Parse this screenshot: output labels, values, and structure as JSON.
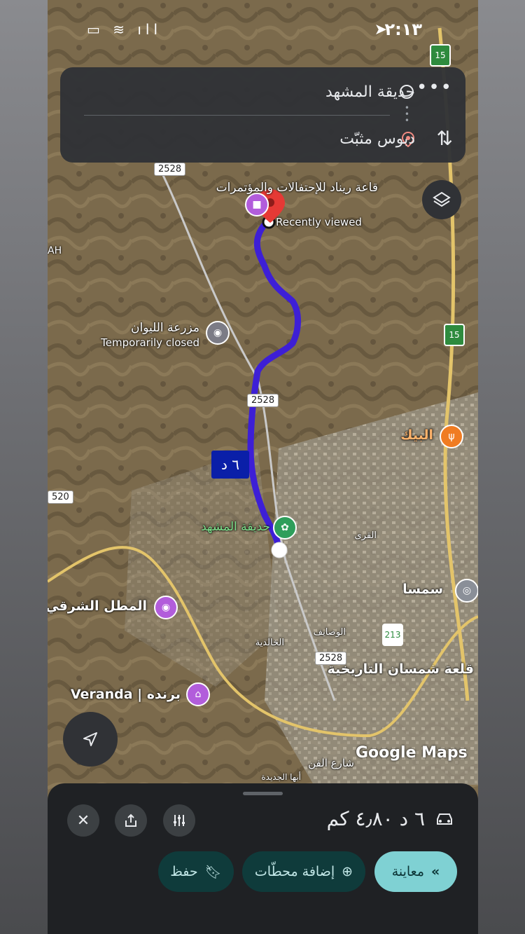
{
  "status_bar": {
    "time": "٢:١٣"
  },
  "route_card": {
    "origin": "حديقة المشهد",
    "destination": "دبوس مثبّت"
  },
  "map": {
    "duration_badge": "٦ د",
    "recently_viewed": "Recently viewed",
    "places": {
      "hall": "قاعة ريناد للإحتفالات والمؤتمرات",
      "farm": "مزرعة الليوان",
      "farm_status": "Temporarily closed",
      "park": "حديقة المشهد",
      "restaurant": "البيك",
      "viewpoint": "المطل الشرقي",
      "veranda": "Veranda | برنده",
      "samsma": "سمسا",
      "castle": "قلعة شمسان التاريخية",
      "khalidiya": "الخالدية",
      "wasayef": "الوصايف",
      "qura": "القرى",
      "art_street": "شارع الفن",
      "new_abha": "أبها الجديدة",
      "left_edge_1": "AH",
      "left_edge_2": "520"
    },
    "road_shields": [
      "2528",
      "2528",
      "2528",
      "213"
    ],
    "highway_shields": [
      "15",
      "15"
    ],
    "watermark": "Google Maps",
    "colors": {
      "route": "#3d1fd6",
      "poi_purple": "#b25ddb",
      "poi_green": "#2e9e5b",
      "poi_orange": "#f07c22"
    }
  },
  "bottom_sheet": {
    "summary": "٦ د ٤٫٨٠ كم",
    "buttons": {
      "preview": "معاينة",
      "add_stops": "إضافة محطّات",
      "save": "حفظ"
    }
  }
}
